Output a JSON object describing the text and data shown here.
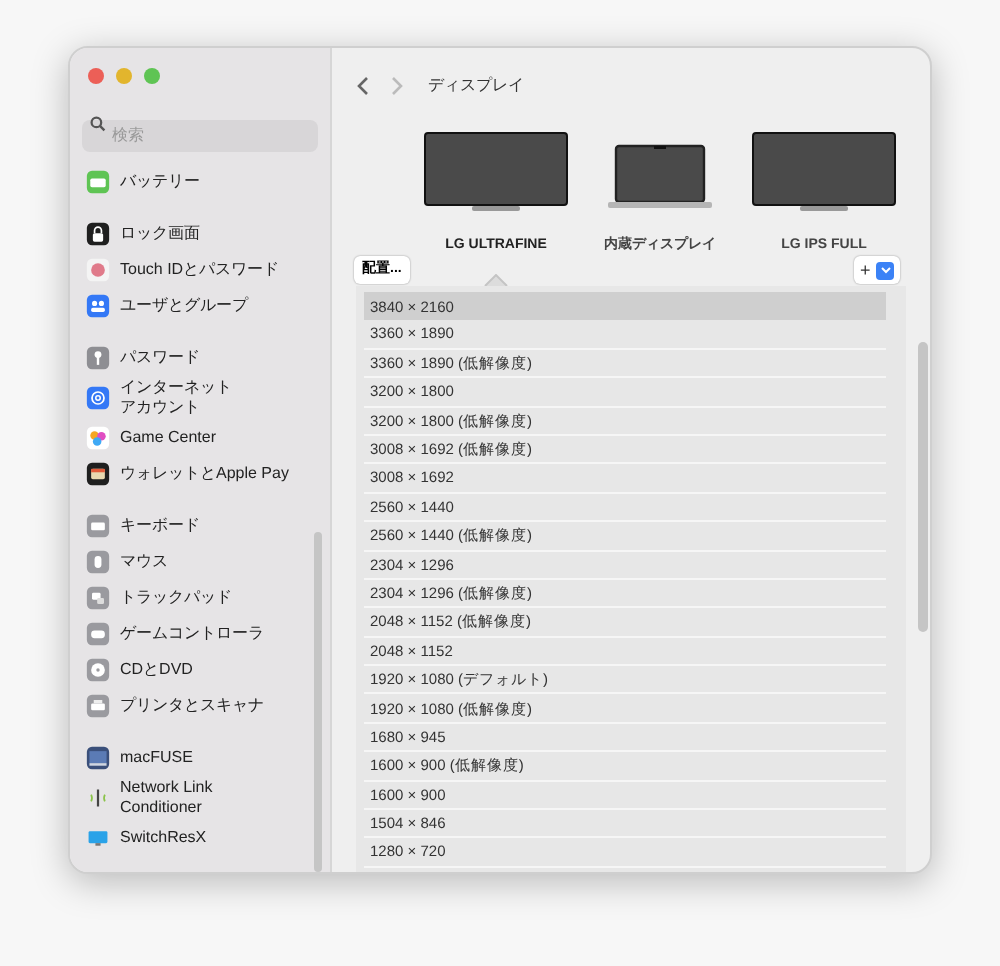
{
  "search": {
    "placeholder": "検索"
  },
  "sidebar": {
    "groups": [
      [
        {
          "label": "バッテリー"
        }
      ],
      [
        {
          "label": "ロック画面"
        },
        {
          "label": "Touch IDとパスワード"
        },
        {
          "label": "ユーザとグループ"
        }
      ],
      [
        {
          "label": "パスワード"
        },
        {
          "lines": [
            "インターネット",
            "アカウント"
          ]
        },
        {
          "label": "Game Center"
        },
        {
          "label": "ウォレットとApple Pay"
        }
      ],
      [
        {
          "label": "キーボード"
        },
        {
          "label": "マウス"
        },
        {
          "label": "トラックパッド"
        },
        {
          "label": "ゲームコントローラ"
        },
        {
          "label": "CDとDVD"
        },
        {
          "label": "プリンタとスキャナ"
        }
      ],
      [
        {
          "label": "macFUSE"
        },
        {
          "label": "Network Link\nConditioner"
        },
        {
          "label": "SwitchResX"
        }
      ]
    ]
  },
  "toolbar": {
    "title": "ディスプレイ"
  },
  "arrange_button": "配置...",
  "displays": [
    {
      "kind": "monitor",
      "label": "LG ULTRAFINE",
      "selected": true
    },
    {
      "kind": "laptop",
      "label": "内蔵ディスプレイ",
      "selected": false
    },
    {
      "kind": "monitor",
      "label": "LG IPS FULL",
      "selected": false
    }
  ],
  "add_button": "+",
  "resolutions": [
    {
      "label": "3840 × 2160",
      "selected": true
    },
    {
      "label": "3360 × 1890",
      "selected": false
    },
    {
      "label": "3360 × 1890 (低解像度)",
      "selected": false
    },
    {
      "label": "3200 × 1800",
      "selected": false
    },
    {
      "label": "3200 × 1800 (低解像度)",
      "selected": false
    },
    {
      "label": "3008 × 1692 (低解像度)",
      "selected": false
    },
    {
      "label": "3008 × 1692",
      "selected": false
    },
    {
      "label": "2560 × 1440",
      "selected": false
    },
    {
      "label": "2560 × 1440 (低解像度)",
      "selected": false
    },
    {
      "label": "2304 × 1296",
      "selected": false
    },
    {
      "label": "2304 × 1296 (低解像度)",
      "selected": false
    },
    {
      "label": "2048 × 1152 (低解像度)",
      "selected": false
    },
    {
      "label": "2048 × 1152",
      "selected": false
    },
    {
      "label": "1920 × 1080 (デフォルト)",
      "selected": false
    },
    {
      "label": "1920 × 1080 (低解像度)",
      "selected": false
    },
    {
      "label": "1680 × 945",
      "selected": false
    },
    {
      "label": "1600 × 900 (低解像度)",
      "selected": false
    },
    {
      "label": "1600 × 900",
      "selected": false
    },
    {
      "label": "1504 × 846",
      "selected": false
    },
    {
      "label": "1280 × 720",
      "selected": false
    }
  ]
}
